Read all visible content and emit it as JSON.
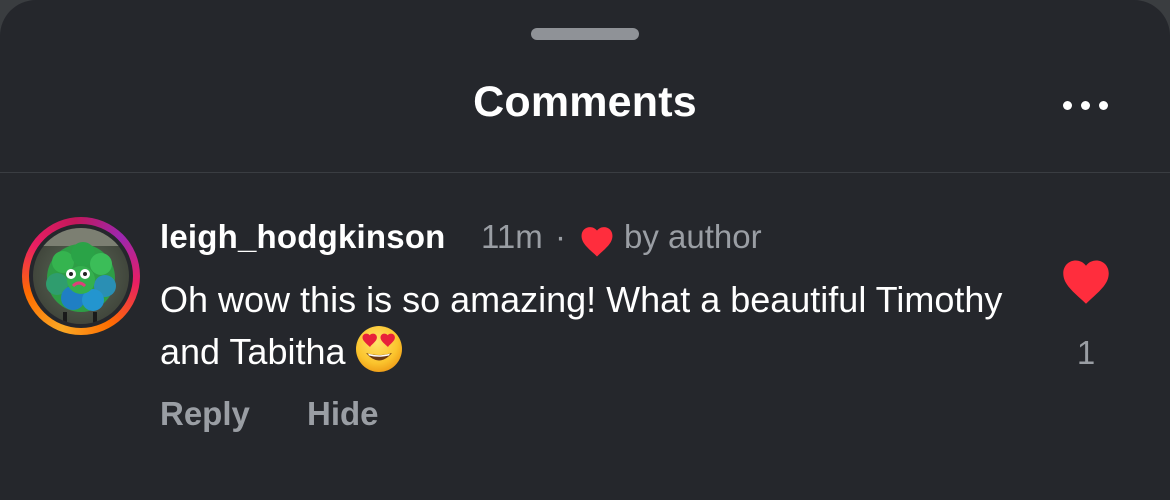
{
  "sheet": {
    "title": "Comments",
    "more_icon": "more-horizontal-icon"
  },
  "comment": {
    "avatar_icon": "avatar",
    "username": "leigh_hodgkinson",
    "time": "11m",
    "separator": "·",
    "author_heart_icon": "heart-icon",
    "author_label": "by author",
    "text": "Oh wow this is so amazing! What a beautiful Timothy and Tabitha",
    "emoji_icon": "heart-eyes-emoji",
    "reply_label": "Reply",
    "hide_label": "Hide",
    "like_icon": "heart-filled-icon",
    "like_count": "1"
  },
  "colors": {
    "background": "#25272c",
    "heart": "#ff2d3d",
    "muted_text": "#9a9ea4",
    "text": "#ffffff"
  }
}
